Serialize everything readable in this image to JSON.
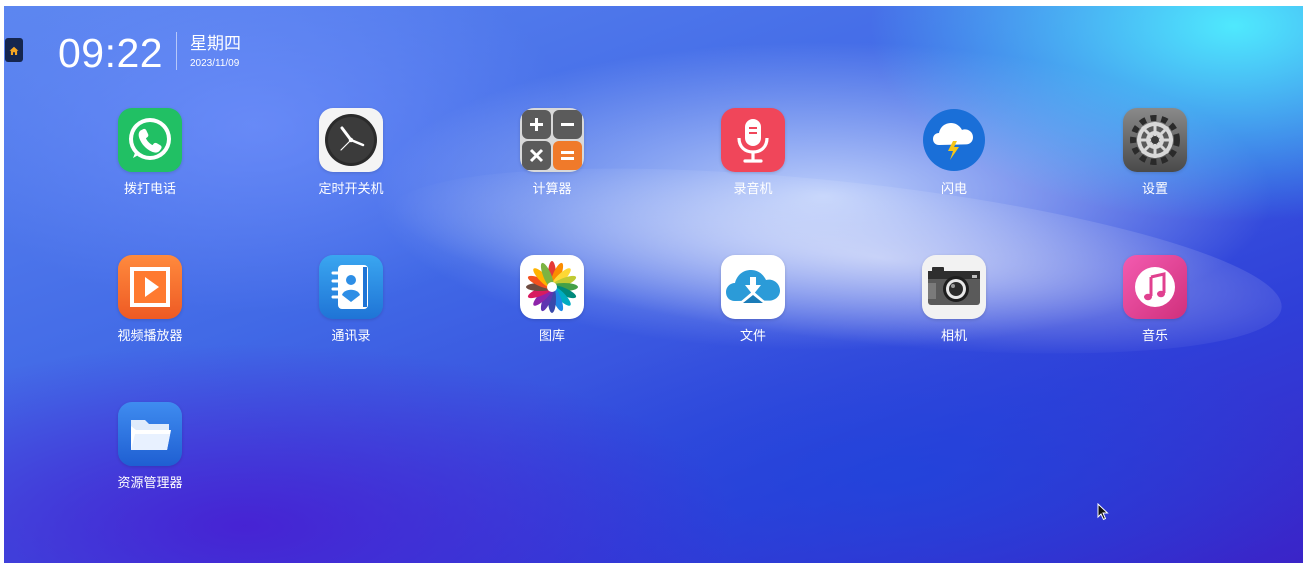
{
  "status_bar": {
    "time": "09:22",
    "weekday": "星期四",
    "date": "2023/11/09"
  },
  "apps": [
    {
      "label": "拨打电话",
      "icon": "phone-icon"
    },
    {
      "label": "定时开关机",
      "icon": "clock-icon"
    },
    {
      "label": "计算器",
      "icon": "calculator-icon"
    },
    {
      "label": "录音机",
      "icon": "microphone-icon"
    },
    {
      "label": "闪电",
      "icon": "lightning-cloud-icon"
    },
    {
      "label": "设置",
      "icon": "gear-icon"
    },
    {
      "label": "视频播放器",
      "icon": "play-icon"
    },
    {
      "label": "通讯录",
      "icon": "contacts-icon"
    },
    {
      "label": "图库",
      "icon": "gallery-icon"
    },
    {
      "label": "文件",
      "icon": "cloud-files-icon"
    },
    {
      "label": "相机",
      "icon": "camera-icon"
    },
    {
      "label": "音乐",
      "icon": "music-note-icon"
    },
    {
      "label": "资源管理器",
      "icon": "folder-icon"
    }
  ],
  "colors": {
    "phone": "#21c064",
    "recorder": "#f0465a",
    "lightning": "#1a6fd8",
    "video": "#f26a2c",
    "contacts": "#2d8ee6",
    "files": "#2b9bd8",
    "music": "#e0408f",
    "folder": "#2f7be8"
  }
}
